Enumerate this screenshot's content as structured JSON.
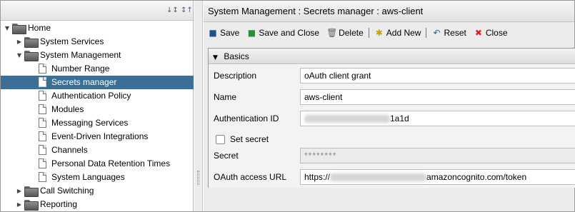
{
  "tree": {
    "items": [
      {
        "label": "Home",
        "type": "folder",
        "expanded": true
      },
      {
        "label": "System Services",
        "type": "folder",
        "expanded": false
      },
      {
        "label": "System Management",
        "type": "folder",
        "expanded": true
      },
      {
        "label": "Number Range",
        "type": "doc"
      },
      {
        "label": "Secrets manager",
        "type": "doc",
        "selected": true
      },
      {
        "label": "Authentication Policy",
        "type": "doc"
      },
      {
        "label": "Modules",
        "type": "doc"
      },
      {
        "label": "Messaging Services",
        "type": "doc"
      },
      {
        "label": "Event-Driven Integrations",
        "type": "doc"
      },
      {
        "label": "Channels",
        "type": "doc"
      },
      {
        "label": "Personal Data Retention Times",
        "type": "doc"
      },
      {
        "label": "System Languages",
        "type": "doc"
      },
      {
        "label": "Call Switching",
        "type": "folder",
        "expanded": false
      },
      {
        "label": "Reporting",
        "type": "folder",
        "expanded": false
      }
    ]
  },
  "header": {
    "breadcrumb": "System Management : Secrets manager : aws-client"
  },
  "toolbar": {
    "save": "Save",
    "save_close": "Save and Close",
    "delete": "Delete",
    "add_new": "Add New",
    "reset": "Reset",
    "close": "Close"
  },
  "form": {
    "section": "Basics",
    "description_label": "Description",
    "description_value": "oAuth client grant",
    "name_label": "Name",
    "name_value": "aws-client",
    "auth_id_label": "Authentication ID",
    "auth_id_suffix": "1a1d",
    "set_secret_label": "Set secret",
    "set_secret_checked": false,
    "secret_label": "Secret",
    "secret_value": "********",
    "oauth_url_label": "OAuth access URL",
    "oauth_url_prefix": "https://",
    "oauth_url_suffix": "amazoncognito.com/token"
  },
  "colors": {
    "selection": "#3c6f96",
    "panel_bg": "#ececec"
  }
}
